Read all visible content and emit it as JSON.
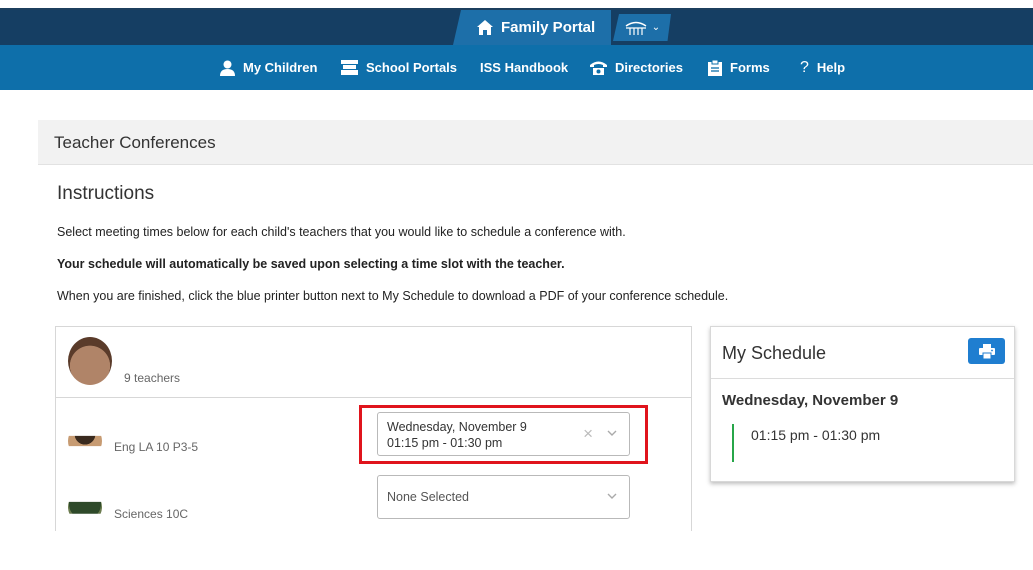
{
  "header": {
    "portal_title": "Family Portal",
    "icons": {
      "home": "home-icon",
      "switcher": "district-logo-icon",
      "switcher_chevron": "chevron-down-icon"
    }
  },
  "nav": {
    "items": [
      {
        "label": "My Children",
        "icon": "person-icon"
      },
      {
        "label": "School Portals",
        "icon": "school-icon"
      },
      {
        "label": "ISS Handbook",
        "icon": ""
      },
      {
        "label": "Directories",
        "icon": "phone-icon"
      },
      {
        "label": "Forms",
        "icon": "clipboard-icon"
      },
      {
        "label": "Help",
        "icon": "question-icon"
      }
    ]
  },
  "panel": {
    "title": "Teacher Conferences"
  },
  "instructions": {
    "title": "Instructions",
    "line1": "Select meeting times below for each child's teachers that you would like to schedule a conference with.",
    "line2": "Your schedule will automatically be saved upon selecting a time slot with the teacher.",
    "line3": "When you are finished, click the blue printer button next to My Schedule to download a PDF of your conference schedule."
  },
  "child": {
    "teacher_count": "9 teachers",
    "teachers": [
      {
        "course": "Eng LA 10 P3-5",
        "selected_date": "Wednesday, November 9",
        "selected_time": "01:15 pm - 01:30 pm"
      },
      {
        "course": "Sciences 10C",
        "placeholder": "None Selected"
      }
    ]
  },
  "schedule": {
    "title": "My Schedule",
    "date": "Wednesday, November 9",
    "time": "01:15 pm - 01:30 pm",
    "accent_color": "#27a649",
    "print_button_color": "#1f7ed0"
  },
  "highlight_color": "#e0141c"
}
